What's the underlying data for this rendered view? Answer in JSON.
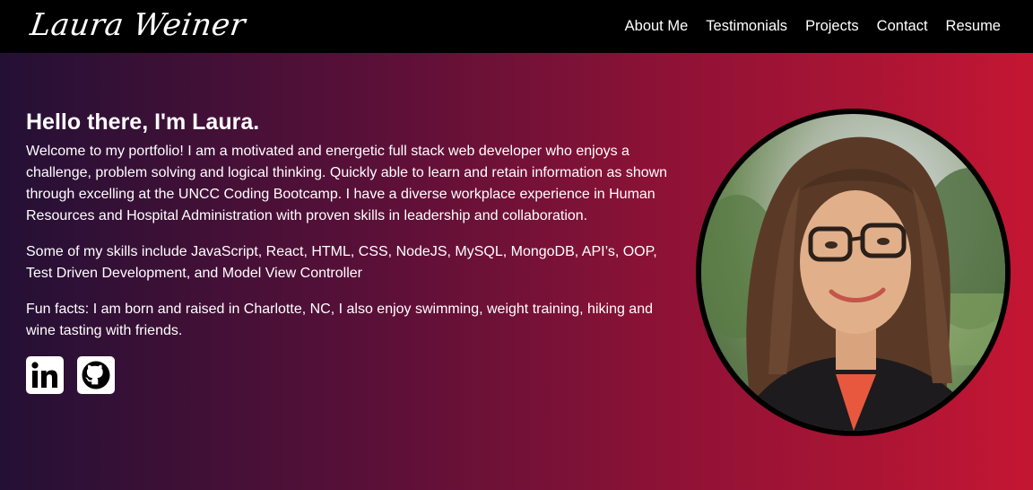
{
  "nav": {
    "logo": "Laura Weiner",
    "links": [
      "About Me",
      "Testimonials",
      "Projects",
      "Contact",
      "Resume"
    ]
  },
  "intro": {
    "heading": "Hello there, I'm Laura.",
    "paragraph1": "Welcome to my portfolio! I am a motivated and energetic full stack web developer who enjoys a challenge, problem solving and logical thinking. Quickly able to learn and retain information as shown through excelling at the UNCC Coding Bootcamp. I have a diverse workplace experience in Human Resources and Hospital Administration with proven skills in leadership and collaboration.",
    "paragraph2": "Some of my skills include JavaScript, React, HTML, CSS, NodeJS, MySQL, MongoDB, API’s, OOP, Test Driven Development, and Model View Controller",
    "paragraph3": "Fun facts: I am born and raised in Charlotte, NC, I also enjoy swimming, weight training, hiking and wine tasting with friends."
  },
  "socials": [
    {
      "icon": "linkedin-icon"
    },
    {
      "icon": "github-icon"
    }
  ],
  "colors": {
    "navbar": "#000000",
    "gradient_start": "#241035",
    "gradient_end": "#c41633",
    "text": "#ffffff"
  }
}
